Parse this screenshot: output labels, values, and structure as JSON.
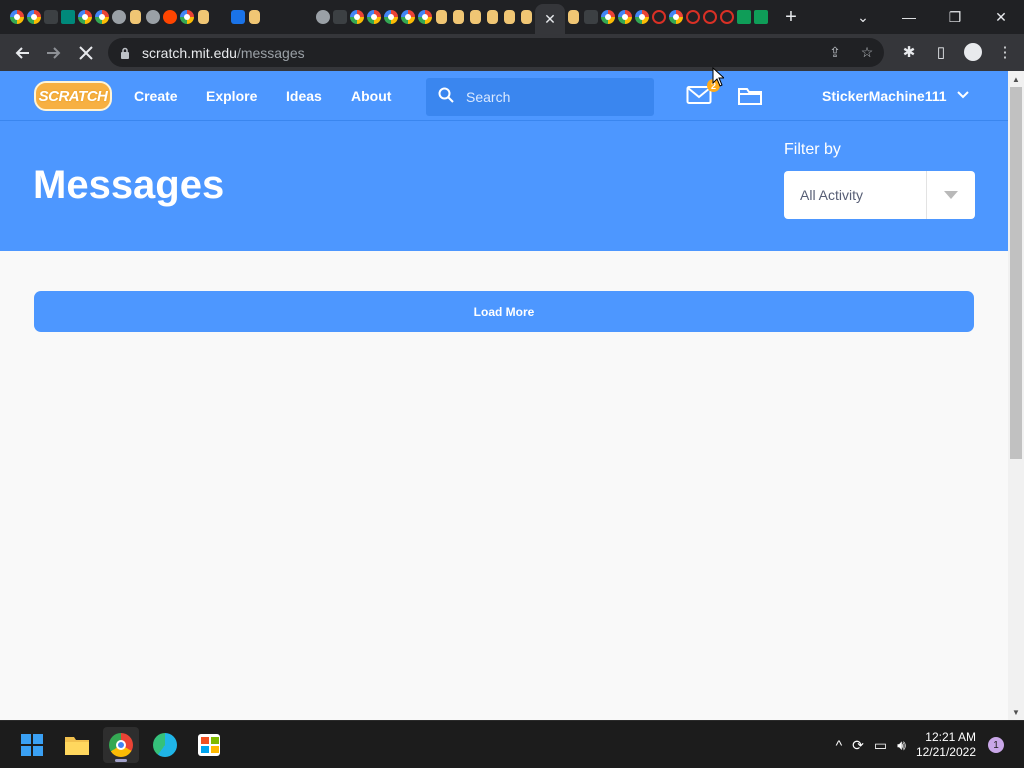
{
  "browser": {
    "tabs": [
      {
        "icon": "google-icon",
        "type": "google"
      },
      {
        "icon": "google-icon",
        "type": "google"
      },
      {
        "icon": "window-icon",
        "type": "dark"
      },
      {
        "icon": "teal-tab-icon",
        "type": "teal"
      },
      {
        "icon": "google-icon",
        "type": "google"
      },
      {
        "icon": "google-icon",
        "type": "google"
      },
      {
        "icon": "wifi-icon",
        "type": "gray"
      },
      {
        "icon": "scratch-icon",
        "type": "scratch"
      },
      {
        "icon": "globe-icon",
        "type": "gray"
      },
      {
        "icon": "reddit-icon",
        "type": "reddit"
      },
      {
        "icon": "google-icon",
        "type": "google"
      },
      {
        "icon": "scratch-icon",
        "type": "scratch"
      },
      {
        "icon": "code-icon",
        "type": "cyan"
      },
      {
        "icon": "blue-tab-icon",
        "type": "blue"
      },
      {
        "icon": "scratch-icon",
        "type": "scratch"
      },
      {
        "icon": "code-icon",
        "type": "cyan"
      },
      {
        "icon": "monitor-icon",
        "type": "cyan"
      },
      {
        "icon": "code-icon",
        "type": "cyan"
      },
      {
        "icon": "doc-icon",
        "type": "gray"
      },
      {
        "icon": "github-icon",
        "type": "dark"
      },
      {
        "icon": "google-icon",
        "type": "google"
      },
      {
        "icon": "google-icon",
        "type": "google"
      },
      {
        "icon": "google-icon",
        "type": "google"
      },
      {
        "icon": "google-icon",
        "type": "google"
      },
      {
        "icon": "google-icon",
        "type": "google"
      },
      {
        "icon": "scratch-icon",
        "type": "scratch"
      },
      {
        "icon": "scratch-icon",
        "type": "scratch"
      },
      {
        "icon": "scratch-icon",
        "type": "scratch"
      },
      {
        "icon": "scratch-icon",
        "type": "scratch"
      },
      {
        "icon": "scratch-icon",
        "type": "scratch"
      },
      {
        "icon": "scratch-icon",
        "type": "scratch"
      }
    ],
    "tabs_after": [
      {
        "icon": "scratch-icon",
        "type": "scratch"
      },
      {
        "icon": "github-icon",
        "type": "dark"
      },
      {
        "icon": "google-icon",
        "type": "google"
      },
      {
        "icon": "google-icon",
        "type": "google"
      },
      {
        "icon": "google-icon",
        "type": "google"
      },
      {
        "icon": "red-ring-icon",
        "type": "red"
      },
      {
        "icon": "google-icon",
        "type": "google"
      },
      {
        "icon": "red-ring-icon",
        "type": "red"
      },
      {
        "icon": "red-ring-icon",
        "type": "red"
      },
      {
        "icon": "bookmark-icon",
        "type": "red"
      },
      {
        "icon": "sheets-icon",
        "type": "green"
      },
      {
        "icon": "sheets-icon",
        "type": "green"
      }
    ],
    "active_tab_close": "✕",
    "new_tab": "+",
    "url_host": "scratch.mit.edu",
    "url_path": "/messages"
  },
  "nav": {
    "logo_text": "SCRATCH",
    "links": [
      "Create",
      "Explore",
      "Ideas",
      "About"
    ],
    "search_placeholder": "Search",
    "message_count": "2",
    "username": "StickerMachine111"
  },
  "banner": {
    "title": "Messages",
    "filter_label": "Filter by",
    "filter_value": "All Activity"
  },
  "content": {
    "load_more": "Load More"
  },
  "taskbar": {
    "time": "12:21 AM",
    "date": "12/21/2022",
    "notifications": "1"
  },
  "colors": {
    "scratch_blue": "#4d97ff",
    "badge_orange": "#ffab1a"
  }
}
